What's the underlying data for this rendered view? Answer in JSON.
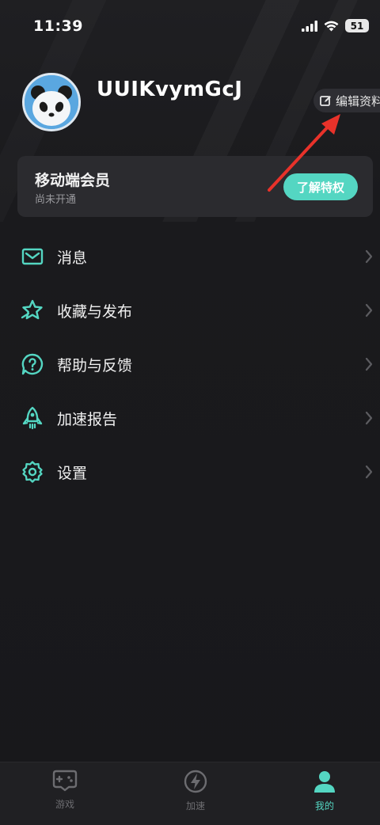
{
  "status_bar": {
    "time": "11:39",
    "battery": "51"
  },
  "profile": {
    "username": "UUIKvymGcJ",
    "edit_label": "编辑资料"
  },
  "member_card": {
    "title": "移动端会员",
    "subtitle": "尚未开通",
    "button_label": "了解特权"
  },
  "menu": {
    "items": [
      {
        "label": "消息",
        "icon": "mail-icon"
      },
      {
        "label": "收藏与发布",
        "icon": "star-icon"
      },
      {
        "label": "帮助与反馈",
        "icon": "help-icon"
      },
      {
        "label": "加速报告",
        "icon": "rocket-icon"
      },
      {
        "label": "设置",
        "icon": "gear-icon"
      }
    ]
  },
  "tabbar": {
    "tabs": [
      {
        "label": "游戏",
        "icon": "gamepad-icon",
        "active": false
      },
      {
        "label": "加速",
        "icon": "lightning-icon",
        "active": false
      },
      {
        "label": "我的",
        "icon": "user-icon",
        "active": true
      }
    ]
  },
  "colors": {
    "accent": "#54d6c2",
    "background": "#19191c",
    "card": "#2b2b2f",
    "annotation": "#e8322a"
  }
}
